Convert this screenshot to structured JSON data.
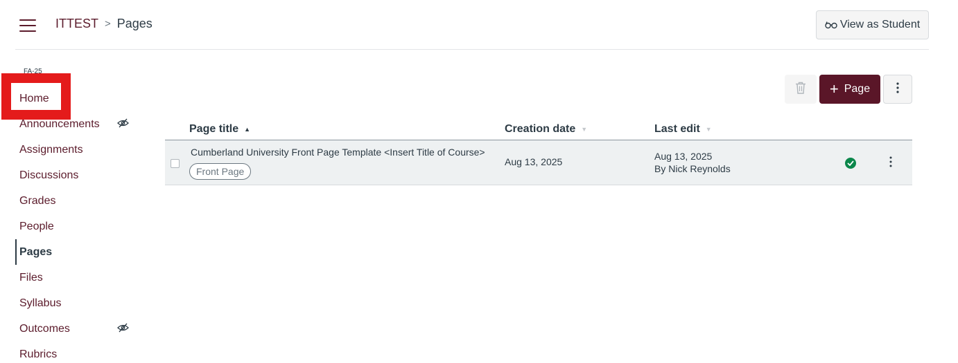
{
  "header": {
    "breadcrumb": {
      "course": "ITTEST",
      "separator": ">",
      "current": "Pages"
    },
    "view_as_student_label": "View as Student"
  },
  "sidebar": {
    "term": "FA-25",
    "items": [
      {
        "label": "Home",
        "active": false,
        "hidden_icon": false
      },
      {
        "label": "Announcements",
        "active": false,
        "hidden_icon": true
      },
      {
        "label": "Assignments",
        "active": false,
        "hidden_icon": false
      },
      {
        "label": "Discussions",
        "active": false,
        "hidden_icon": false
      },
      {
        "label": "Grades",
        "active": false,
        "hidden_icon": false
      },
      {
        "label": "People",
        "active": false,
        "hidden_icon": false
      },
      {
        "label": "Pages",
        "active": true,
        "hidden_icon": false
      },
      {
        "label": "Files",
        "active": false,
        "hidden_icon": false
      },
      {
        "label": "Syllabus",
        "active": false,
        "hidden_icon": false
      },
      {
        "label": "Outcomes",
        "active": false,
        "hidden_icon": true
      },
      {
        "label": "Rubrics",
        "active": false,
        "hidden_icon": false
      }
    ]
  },
  "toolbar": {
    "add_page_label": "Page",
    "add_page_icon": "plus-icon",
    "delete_icon": "trash-icon",
    "more_icon": "kebab-icon"
  },
  "table": {
    "columns": {
      "title": "Page title",
      "created": "Creation date",
      "last_edit": "Last edit"
    },
    "sort_indicator": "▲",
    "inactive_sort_indicator": "▼",
    "rows": [
      {
        "title": "Cumberland University Front Page Template <Insert Title of Course>",
        "badge": "Front Page",
        "created": "Aug 13, 2025",
        "last_edit_date": "Aug 13, 2025",
        "last_edit_by": "By Nick Reynolds",
        "published": true
      }
    ]
  },
  "colors": {
    "brand": "#5a1628",
    "link": "#5b1b2b",
    "text": "#2d3b45",
    "published": "#0b874b",
    "highlight": "#e41b1b",
    "row_background": "#eef1f2"
  }
}
